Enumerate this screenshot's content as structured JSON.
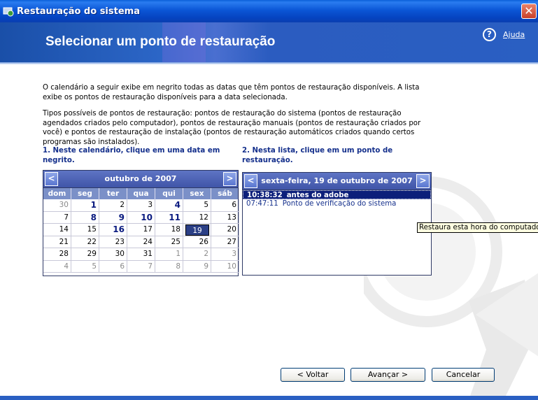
{
  "window": {
    "title": "Restauração do sistema",
    "close_label": "✕"
  },
  "header": {
    "title": "Selecionar um ponto de restauração",
    "help_icon": "?",
    "help_label": "Ajuda"
  },
  "description": {
    "paragraph1": "O calendário a seguir exibe em negrito todas as datas que têm pontos de restauração disponíveis. A lista exibe os pontos de restauração disponíveis para a data selecionada.",
    "paragraph2": "Tipos possíveis de pontos de restauração: pontos de restauração do sistema (pontos de restauração agendados criados pelo computador), pontos de restauração manuais (pontos de restauração criados por você) e pontos de restauração de instalação (pontos de restauração automáticos criados quando certos programas são instalados)."
  },
  "steps": {
    "step1": "1. Neste calendário, clique em uma data em negrito.",
    "step2": "2. Nesta lista, clique em um ponto de restauração."
  },
  "calendar": {
    "month_label": "outubro de 2007",
    "prev": "<",
    "next": ">",
    "weekdays": [
      "dom",
      "seg",
      "ter",
      "qua",
      "qui",
      "sex",
      "sáb"
    ],
    "cells": [
      {
        "d": "30",
        "t": "other"
      },
      {
        "d": "1",
        "t": "bold"
      },
      {
        "d": "2",
        "t": ""
      },
      {
        "d": "3",
        "t": ""
      },
      {
        "d": "4",
        "t": "bold"
      },
      {
        "d": "5",
        "t": ""
      },
      {
        "d": "6",
        "t": ""
      },
      {
        "d": "7",
        "t": ""
      },
      {
        "d": "8",
        "t": "bold"
      },
      {
        "d": "9",
        "t": "bold"
      },
      {
        "d": "10",
        "t": "bold"
      },
      {
        "d": "11",
        "t": "bold"
      },
      {
        "d": "12",
        "t": ""
      },
      {
        "d": "13",
        "t": ""
      },
      {
        "d": "14",
        "t": ""
      },
      {
        "d": "15",
        "t": ""
      },
      {
        "d": "16",
        "t": "bold"
      },
      {
        "d": "17",
        "t": ""
      },
      {
        "d": "18",
        "t": ""
      },
      {
        "d": "19",
        "t": "selected"
      },
      {
        "d": "20",
        "t": ""
      },
      {
        "d": "21",
        "t": ""
      },
      {
        "d": "22",
        "t": ""
      },
      {
        "d": "23",
        "t": ""
      },
      {
        "d": "24",
        "t": ""
      },
      {
        "d": "25",
        "t": ""
      },
      {
        "d": "26",
        "t": ""
      },
      {
        "d": "27",
        "t": ""
      },
      {
        "d": "28",
        "t": ""
      },
      {
        "d": "29",
        "t": ""
      },
      {
        "d": "30",
        "t": ""
      },
      {
        "d": "31",
        "t": ""
      },
      {
        "d": "1",
        "t": "other"
      },
      {
        "d": "2",
        "t": "other"
      },
      {
        "d": "3",
        "t": "other"
      },
      {
        "d": "4",
        "t": "other"
      },
      {
        "d": "5",
        "t": "other"
      },
      {
        "d": "6",
        "t": "other"
      },
      {
        "d": "7",
        "t": "other"
      },
      {
        "d": "8",
        "t": "other"
      },
      {
        "d": "9",
        "t": "other"
      },
      {
        "d": "10",
        "t": "other"
      }
    ]
  },
  "restore_list": {
    "date_label": "sexta-feira, 19 de outubro de 2007",
    "prev": "<",
    "next": ">",
    "items": [
      {
        "time": "10:38:32",
        "label": "antes do adobe",
        "selected": true
      },
      {
        "time": "07:47:11",
        "label": "Ponto de verificação do sistema",
        "selected": false
      }
    ]
  },
  "tooltip": "Restaura esta hora do computador",
  "buttons": {
    "back": "< Voltar",
    "next": "Avançar >",
    "cancel": "Cancelar"
  }
}
